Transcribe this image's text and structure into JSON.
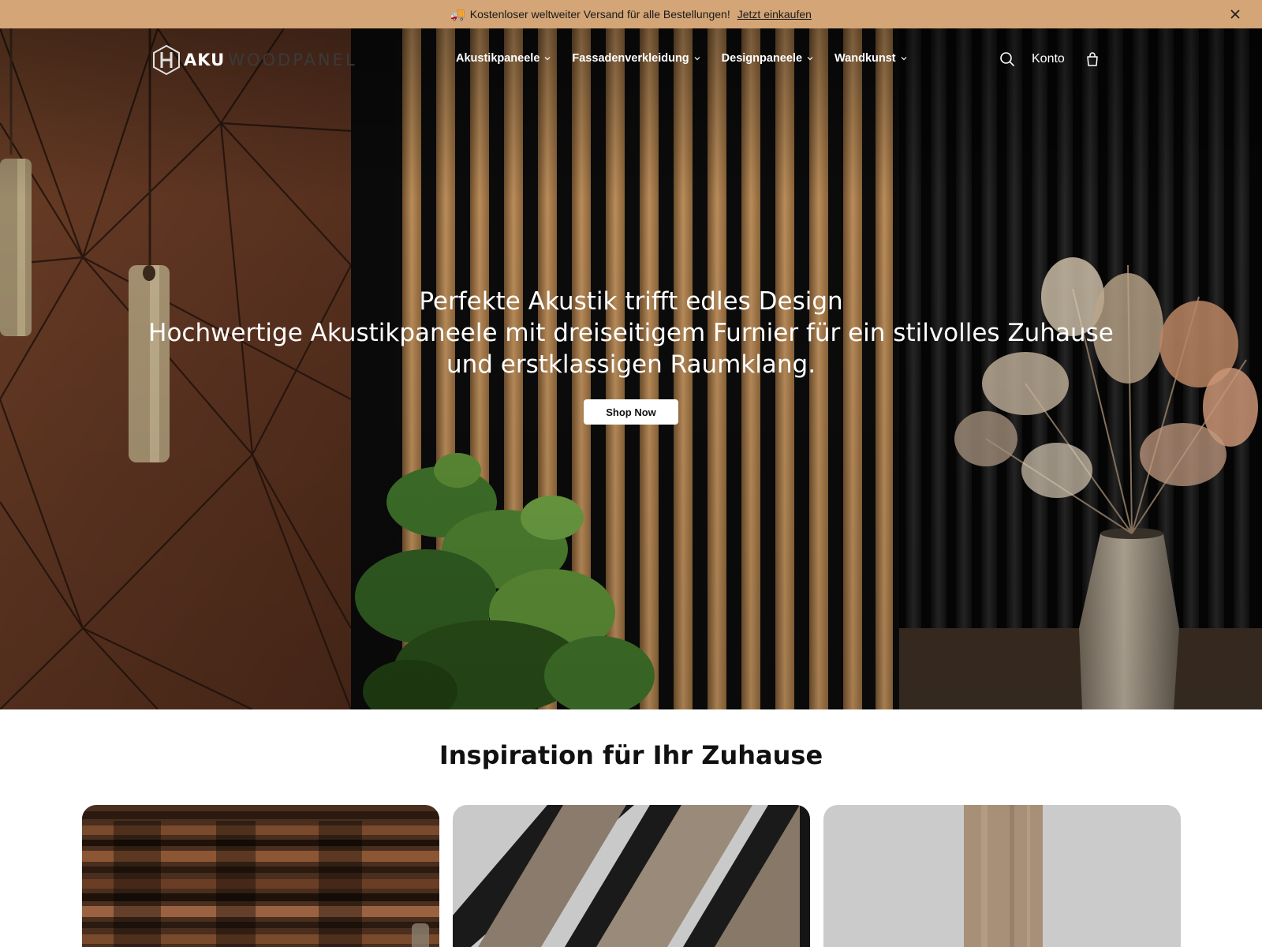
{
  "announcement": {
    "icon": "truck-icon",
    "emoji": "🚚",
    "text": "Kostenloser weltweiter Versand für alle Bestellungen!",
    "cta": "Jetzt einkaufen",
    "close_icon": "close-icon"
  },
  "logo": {
    "part1": "AKU",
    "part2": "WOODPANEL"
  },
  "nav": {
    "items": [
      {
        "label": "Akustikpaneele"
      },
      {
        "label": "Fassadenverkleidung"
      },
      {
        "label": "Designpaneele"
      },
      {
        "label": "Wandkunst"
      }
    ]
  },
  "utils": {
    "search_icon": "search-icon",
    "account_label": "Konto",
    "cart_icon": "bag-icon"
  },
  "hero": {
    "title": "Perfekte Akustik trifft edles Design",
    "subtitle": "Hochwertige Akustikpaneele mit dreiseitigem Furnier für ein stilvolles Zuhause und erstklassigen Raumklang.",
    "button": "Shop Now"
  },
  "inspiration": {
    "title": "Inspiration für Ihr Zuhause"
  },
  "colors": {
    "announcement_bg": "#d4a576",
    "hero_text": "#ffffff"
  }
}
